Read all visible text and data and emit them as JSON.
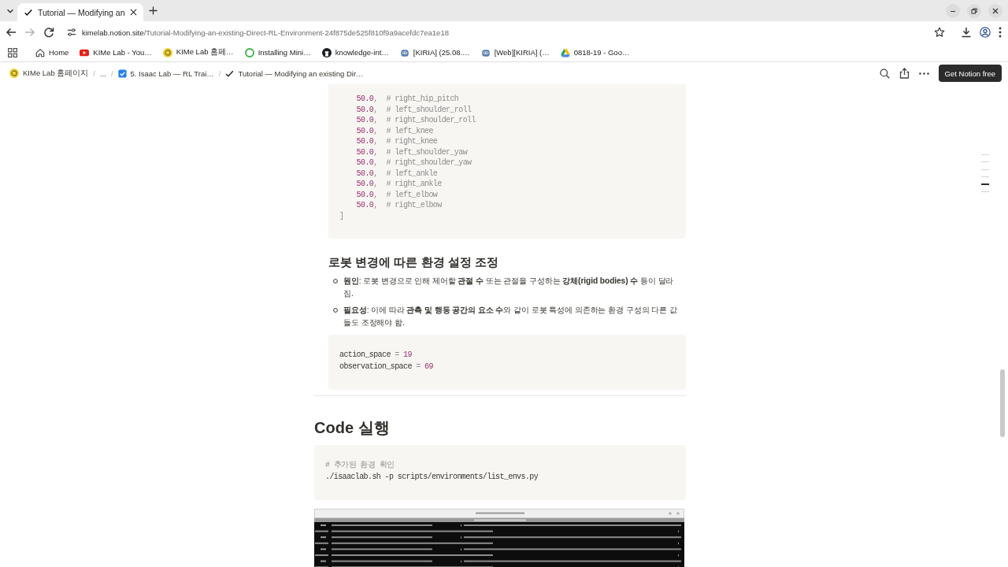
{
  "browser": {
    "tabs": [
      {
        "title": "Tutorial — Modifying an",
        "selected": true
      }
    ],
    "nav_buttons": [
      {
        "kind": "back",
        "disabled": false
      },
      {
        "kind": "forward",
        "disabled": true
      },
      {
        "kind": "reload",
        "disabled": false
      }
    ],
    "address": {
      "host": "kimelab.notion.site",
      "path": "/Tutorial-Modifying-an-existing-Direct-RL-Environment-24f875de525f810f9a9acefdc7ea1e18"
    },
    "bookmarks": [
      {
        "kind": "home",
        "label": "Home"
      },
      {
        "kind": "video",
        "label": "KIMe Lab - You…"
      },
      {
        "kind": "logo",
        "label": "KIMe Lab 홈페…"
      },
      {
        "kind": "ring",
        "label": "Installing Mini…"
      },
      {
        "kind": "cat",
        "label": "knowledge-int…"
      },
      {
        "kind": "robot",
        "label": "[KIRIA] (25.08.…"
      },
      {
        "kind": "robot",
        "label": "[Web][KIRIA] (…"
      },
      {
        "kind": "drive",
        "label": "0818-19 - Goo…"
      }
    ]
  },
  "notion_topbar": {
    "breadcrumbs": [
      {
        "kind": "logo",
        "label": "KIMe Lab 홈페이지"
      },
      {
        "kind": "collapsed",
        "separator": "/",
        "label": "..."
      },
      {
        "kind": "checkbox",
        "separator": "/",
        "label": "5. Isaac Lab — RL Trai…"
      },
      {
        "kind": "check",
        "separator": "/",
        "label": "Tutorial — Modifying an existing Dir…"
      }
    ],
    "cta_button": "Get Notion free"
  },
  "page": {
    "blocks": [
      {
        "kind": "nested",
        "children": [
          {
            "kind": "code",
            "children": [
              "50.0,  # right_hip_pitch",
              "50.0,  # left_shoulder_roll",
              "50.0,  # right_shoulder_roll",
              "50.0,  # left_knee",
              "50.0,  # right_knee",
              "50.0,  # left_shoulder_yaw",
              "50.0,  # right_shoulder_yaw",
              "50.0,  # left_ankle",
              "50.0,  # right_ankle",
              "50.0,  # left_elbow",
              "50.0,  # right_elbow"
            ],
            "lines": [
              "]"
            ]
          },
          {
            "kind": "heading_2",
            "text": "로봇 변경에 따른 환경 설정 조정"
          },
          {
            "kind": "bulleted_list",
            "items": [
              {
                "text": "**원인**: 로봇 변경으로 인해 제어할 **관절 수** 또는 관절을 구성하는 **강체(rigid bodies) 수** 등이 달라짐."
              },
              {
                "text": "**필요성**: 이에 따라 **관측 및 행동 공간의 요소 수**와 같이 로봇 특성에 의존하는 환경 구성의 다른 값들도 조정해야 함."
              }
            ]
          },
          {
            "kind": "code",
            "lines": [
              "action_space = 19",
              "observation_space = 69"
            ]
          }
        ]
      },
      {
        "kind": "divider"
      },
      {
        "kind": "heading_1",
        "text": "Code 실행"
      },
      {
        "kind": "code",
        "lines": [
          "# 추가된 환경 확인",
          "./isaaclab.sh -p scripts/environments/list_envs.py"
        ]
      },
      {
        "kind": "image"
      }
    ]
  },
  "toc": [
    {
      "selected": false
    },
    {
      "selected": false
    },
    {
      "selected": false
    },
    {
      "selected": false
    },
    {
      "selected": true
    },
    {
      "selected": false
    }
  ]
}
